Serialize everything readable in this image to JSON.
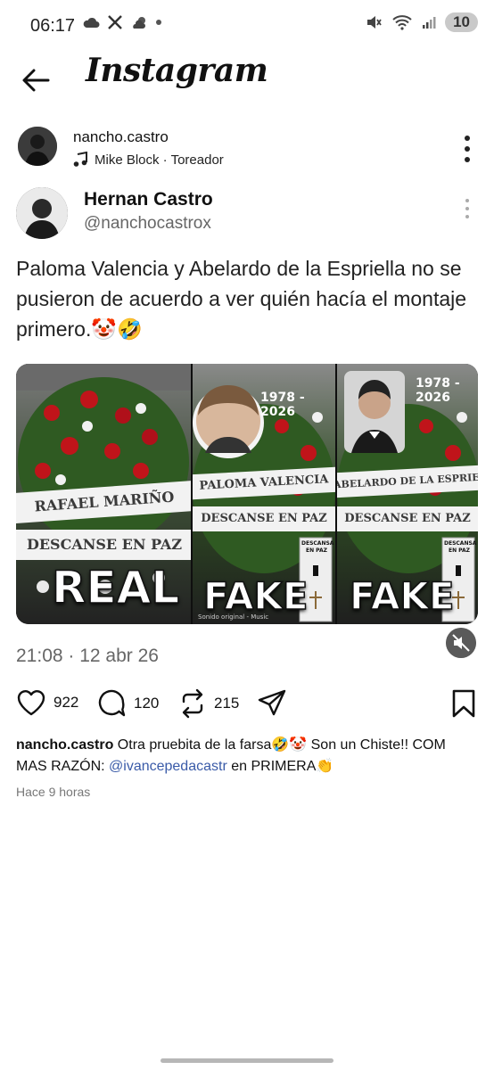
{
  "status_bar": {
    "time": "06:17",
    "battery": "10"
  },
  "app": {
    "title": "Instagram"
  },
  "post": {
    "username": "nancho.castro",
    "audio": "Mike Block · Toreador",
    "tweet": {
      "name": "Hernan Castro",
      "handle": "@nanchocastrox",
      "text": "Paloma Valencia y Abelardo de la Espriella no se pusieron de acuerdo a ver quién hacía el montaje primero.🤡🤣",
      "date": "21:08 · 12 abr 26"
    },
    "media": {
      "panel1_ribbon_top": "RAFAEL MARIÑO",
      "panel1_ribbon_bottom": "DESCANSE EN PAZ",
      "panel1_label": "REAL",
      "panel2_years": "1978 - 2026",
      "panel2_ribbon_top": "PALOMA VALENCIA",
      "panel2_ribbon_bottom": "DESCANSE EN PAZ",
      "panel2_label": "FAKE",
      "panel2_card_title": "DESCANSA EN PAZ",
      "panel2_audio": "Sonido original - Music",
      "panel3_years": "1978 - 2026",
      "panel3_ribbon_top": "ABELARDO DE LA ESPRIELLA",
      "panel3_ribbon_bottom": "DESCANSE EN PAZ",
      "panel3_label": "FAKE",
      "panel3_card_title": "DESCANSA EN PAZ"
    },
    "actions": {
      "likes": "922",
      "comments": "120",
      "reposts": "215"
    },
    "caption": {
      "username": "nancho.castro",
      "text": " Otra pruebita de la farsa🤣🤡 Son un Chiste!! COM MAS RAZÓN: ",
      "mention": "@ivancepedacastr",
      "text_end": " en PRIMERA👏"
    },
    "time_ago": "Hace 9 horas"
  }
}
